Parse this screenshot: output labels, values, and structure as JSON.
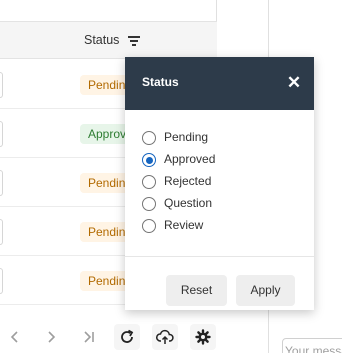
{
  "table": {
    "column_header": "Status",
    "rows": [
      {
        "status": "Pending",
        "kind": "pending"
      },
      {
        "status": "Approved",
        "kind": "approved"
      },
      {
        "status": "Pending",
        "kind": "pending"
      },
      {
        "status": "Pending",
        "kind": "pending"
      },
      {
        "status": "Pending",
        "kind": "pending"
      }
    ]
  },
  "filter_popup": {
    "title": "Status",
    "close_glyph": "✕",
    "options": [
      {
        "label": "Pending",
        "selected": false
      },
      {
        "label": "Approved",
        "selected": true
      },
      {
        "label": "Rejected",
        "selected": false
      },
      {
        "label": "Question",
        "selected": false
      },
      {
        "label": "Review",
        "selected": false
      }
    ],
    "reset_label": "Reset",
    "apply_label": "Apply"
  },
  "pagination": {
    "icons": [
      "chevron-left-icon",
      "chevron-right-icon",
      "last-page-icon",
      "refresh-icon",
      "cloud-upload-icon",
      "gear-icon"
    ]
  },
  "chat": {
    "placeholder": "Your message"
  },
  "colors": {
    "popup_header": "#2d3b4a",
    "radio_selected": "#1565c0",
    "pending_badge_bg": "#fff4e5",
    "pending_badge_text": "#b26a00",
    "approved_badge_bg": "#e7f5e9",
    "approved_badge_text": "#2e7d32"
  }
}
